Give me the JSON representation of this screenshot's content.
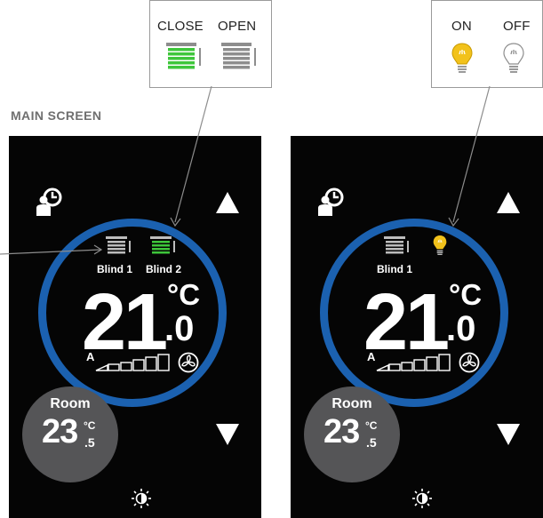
{
  "main_screen_label": "MAIN SCREEN",
  "blind_legend": {
    "close_label": "CLOSE",
    "open_label": "OPEN"
  },
  "light_legend": {
    "on_label": "ON",
    "off_label": "OFF"
  },
  "colors": {
    "ring": "#1b61b0",
    "blind_closed": "#3ec63b",
    "blind_open": "#bdbdbd",
    "bulb_on": "#f2c21b",
    "room_bg": "#555557"
  },
  "left_panel": {
    "blind1_label": "Blind 1",
    "blind2_label": "Blind 2",
    "setpoint_int": "21",
    "setpoint_unit": "°C",
    "setpoint_dec": ".0",
    "fan_mode": "A",
    "room_label": "Room",
    "room_temp_int": "23",
    "room_temp_unit": "°C",
    "room_temp_dec": ".5"
  },
  "right_panel": {
    "blind1_label": "Blind 1",
    "setpoint_int": "21",
    "setpoint_unit": "°C",
    "setpoint_dec": ".0",
    "fan_mode": "A",
    "room_label": "Room",
    "room_temp_int": "23",
    "room_temp_unit": "°C",
    "room_temp_dec": ".5"
  }
}
